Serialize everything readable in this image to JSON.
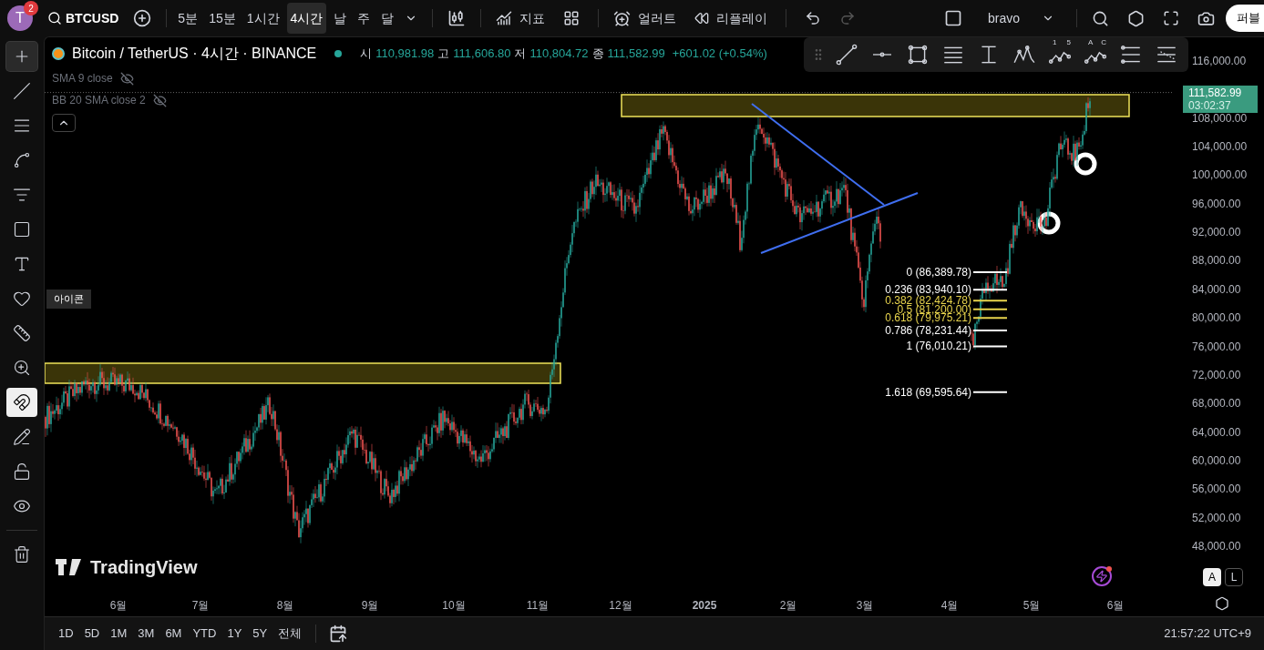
{
  "top_bar": {
    "avatar": "T",
    "notifications": "2",
    "symbol": "BTCUSD",
    "intervals": [
      {
        "label": "5분",
        "selected": false
      },
      {
        "label": "15분",
        "selected": false
      },
      {
        "label": "1시간",
        "selected": false
      },
      {
        "label": "4시간",
        "selected": true
      },
      {
        "label": "날",
        "selected": false
      },
      {
        "label": "주",
        "selected": false
      },
      {
        "label": "달",
        "selected": false
      }
    ],
    "indicators": "지표",
    "alert": "얼러트",
    "replay": "리플레이",
    "redo_disabled": true,
    "layout": "bravo",
    "publish": "퍼블"
  },
  "left_toolbar": [
    {
      "kind": "crosshair",
      "selected": true,
      "on": false
    },
    {
      "kind": "trendline",
      "selected": false,
      "on": false
    },
    {
      "kind": "lines",
      "selected": false,
      "on": false
    },
    {
      "kind": "pattern",
      "selected": false,
      "on": false
    },
    {
      "kind": "fib",
      "selected": false,
      "on": false
    },
    {
      "kind": "rectangle",
      "selected": false,
      "on": false
    },
    {
      "kind": "text",
      "selected": false,
      "on": false
    },
    {
      "kind": "heart",
      "selected": false,
      "on": false,
      "tooltip": "아이콘"
    },
    {
      "kind": "ruler",
      "selected": false,
      "on": false
    },
    {
      "kind": "zoom",
      "selected": false,
      "on": false
    },
    {
      "kind": "magnet",
      "selected": false,
      "on": true
    },
    {
      "kind": "pencil-lock",
      "selected": false,
      "on": false
    },
    {
      "kind": "lock",
      "selected": false,
      "on": false
    },
    {
      "kind": "eye",
      "selected": false,
      "on": false
    },
    {
      "kind": "trash",
      "selected": false,
      "on": false
    }
  ],
  "legend": {
    "title": "Bitcoin / TetherUS · 4시간 · BINANCE",
    "ohlc": [
      {
        "label": "시",
        "value": "110,981.98"
      },
      {
        "label": "고",
        "value": "111,606.80"
      },
      {
        "label": "저",
        "value": "110,804.72"
      },
      {
        "label": "종",
        "value": "111,582.99"
      }
    ],
    "change": "+601.02 (+0.54%)",
    "indicators": [
      "SMA 9 close",
      "BB 20 SMA close 2"
    ]
  },
  "drawing_toolbar": [
    {
      "kind": "trendline"
    },
    {
      "kind": "ray"
    },
    {
      "kind": "rectangle"
    },
    {
      "kind": "parallel"
    },
    {
      "kind": "measure"
    },
    {
      "kind": "pattern"
    },
    {
      "kind": "wave",
      "labels": [
        "1",
        "5"
      ]
    },
    {
      "kind": "wave",
      "labels": [
        "A",
        "C"
      ]
    },
    {
      "kind": "fib"
    },
    {
      "kind": "fan"
    }
  ],
  "fib_levels": [
    {
      "label": "0 (86,389.78)",
      "color": "#ffffff"
    },
    {
      "label": "0.236 (83,940.10)",
      "color": "#ffffff"
    },
    {
      "label": "0.382 (82,424.78)",
      "color": "#e8d44d"
    },
    {
      "label": "0.5 (81,200.00)",
      "color": "#e8d44d"
    },
    {
      "label": "0.618 (79,975.21)",
      "color": "#e8d44d"
    },
    {
      "label": "0.786 (78,231.44)",
      "color": "#ffffff"
    },
    {
      "label": "1 (76,010.21)",
      "color": "#ffffff"
    },
    {
      "label": "1.618 (69,595.64)",
      "color": "#ffffff"
    }
  ],
  "price_axis": [
    "116,000.00",
    "108,000.00",
    "104,000.00",
    "100,000.00",
    "96,000.00",
    "92,000.00",
    "88,000.00",
    "84,000.00",
    "80,000.00",
    "76,000.00",
    "72,000.00",
    "68,000.00",
    "64,000.00",
    "60,000.00",
    "56,000.00",
    "52,000.00",
    "48,000.00"
  ],
  "price_badge": {
    "price": "111,582.99",
    "countdown": "03:02:37"
  },
  "watermark": "TradingView",
  "scale_buttons": [
    {
      "label": "A",
      "selected": true
    },
    {
      "label": "L",
      "selected": false
    }
  ],
  "time_axis": [
    {
      "label": "6월",
      "kind": "month"
    },
    {
      "label": "7월",
      "kind": "month"
    },
    {
      "label": "8월",
      "kind": "month"
    },
    {
      "label": "9월",
      "kind": "month"
    },
    {
      "label": "10월",
      "kind": "month"
    },
    {
      "label": "11월",
      "kind": "month"
    },
    {
      "label": "12월",
      "kind": "month"
    },
    {
      "label": "2025",
      "kind": "year"
    },
    {
      "label": "2월",
      "kind": "month"
    },
    {
      "label": "3월",
      "kind": "month"
    },
    {
      "label": "4월",
      "kind": "month"
    },
    {
      "label": "5월",
      "kind": "month"
    },
    {
      "label": "6월",
      "kind": "month"
    }
  ],
  "ranges": [
    "1D",
    "5D",
    "1M",
    "3M",
    "6M",
    "YTD",
    "1Y",
    "5Y",
    "전체"
  ],
  "clock": "21:57:22 UTC+9"
}
